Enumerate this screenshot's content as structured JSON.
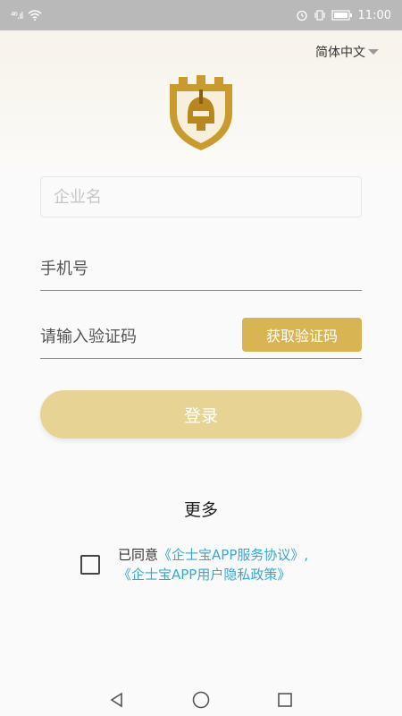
{
  "status_bar": {
    "signal": "⁴⁶.ıl",
    "time": "11:00"
  },
  "header": {
    "language": "简体中文"
  },
  "form": {
    "company_placeholder": "企业名",
    "phone_placeholder": "手机号",
    "code_placeholder": "请输入验证码",
    "get_code_label": "获取验证码",
    "login_label": "登录"
  },
  "more_label": "更多",
  "agreement": {
    "prefix": "已同意",
    "service_link": "《企士宝APP服务协议》,",
    "privacy_link": "《企士宝APP用户隐私政策》"
  },
  "colors": {
    "accent": "#d8b452",
    "login_button": "#e7d495",
    "link": "#33a9d6"
  }
}
